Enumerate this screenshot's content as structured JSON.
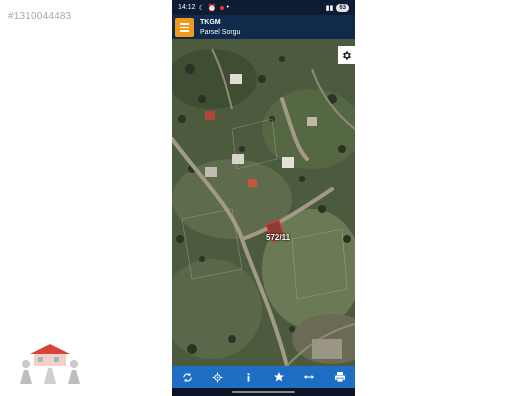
{
  "watermark": {
    "text": "#1310044483"
  },
  "status_bar": {
    "time": "14:12",
    "battery": "63"
  },
  "app_bar": {
    "title": "TKGM",
    "subtitle": "Parsel Sorgu"
  },
  "map": {
    "parcel_label": "572/11"
  },
  "toolbar": {
    "items": [
      {
        "icon": "refresh-icon"
      },
      {
        "icon": "locate-icon"
      },
      {
        "icon": "info-icon"
      },
      {
        "icon": "star-icon"
      },
      {
        "icon": "measure-icon"
      },
      {
        "icon": "print-icon"
      }
    ]
  },
  "colors": {
    "status_bg": "#0d1b33",
    "app_bar_bg": "#0f2a4a",
    "menu_button": "#f39a1e",
    "toolbar_bg": "#1e6fc4",
    "parcel_outline": "#e53935"
  }
}
